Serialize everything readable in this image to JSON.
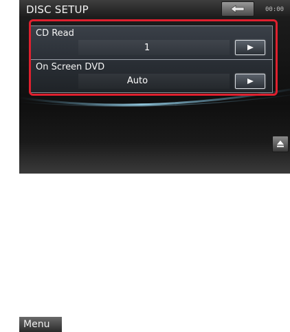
{
  "header": {
    "title": "DISC SETUP",
    "clock": "00:00",
    "back_icon": "back-arrow-icon"
  },
  "settings": [
    {
      "label": "CD Read",
      "value": "1",
      "button_icon": "right-triangle-icon"
    },
    {
      "label": "On Screen DVD",
      "value": "Auto",
      "button_icon": "right-triangle-icon"
    }
  ],
  "footer": {
    "menu_label": "Menu",
    "side_icon": "eject-icon"
  },
  "colors": {
    "highlight": "#e0202e",
    "background": "#0f0f0f",
    "text": "#ffffff"
  }
}
